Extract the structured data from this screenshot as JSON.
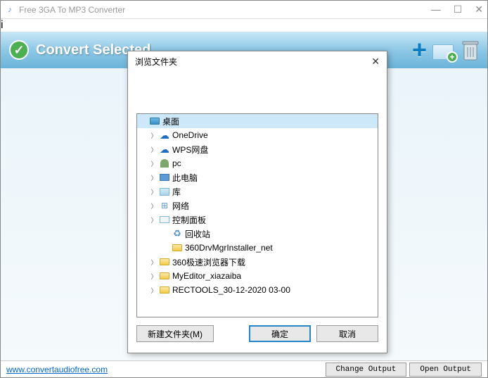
{
  "titlebar": {
    "title": "Free 3GA To MP3 Converter"
  },
  "toolbar": {
    "convert_label": "Convert Selected"
  },
  "footer": {
    "url": "www.convertaudiofree.com",
    "change_output": "Change Output",
    "open_output": "Open Output"
  },
  "dialog": {
    "title": "浏览文件夹",
    "new_folder": "新建文件夹(M)",
    "ok": "确定",
    "cancel": "取消",
    "tree": [
      {
        "label": "桌面",
        "icon": "desktop",
        "level": 0,
        "selected": true,
        "expandable": false
      },
      {
        "label": "OneDrive",
        "icon": "cloud",
        "level": 1,
        "expandable": true
      },
      {
        "label": "WPS网盘",
        "icon": "cloud",
        "level": 1,
        "expandable": true
      },
      {
        "label": "pc",
        "icon": "person",
        "level": 1,
        "expandable": true
      },
      {
        "label": "此电脑",
        "icon": "computer",
        "level": 1,
        "expandable": true
      },
      {
        "label": "库",
        "icon": "lib",
        "level": 1,
        "expandable": true
      },
      {
        "label": "网络",
        "icon": "network",
        "level": 1,
        "expandable": true
      },
      {
        "label": "控制面板",
        "icon": "panel",
        "level": 1,
        "expandable": true
      },
      {
        "label": "回收站",
        "icon": "recycle",
        "level": 2,
        "expandable": false
      },
      {
        "label": "360DrvMgrInstaller_net",
        "icon": "folder",
        "level": 2,
        "expandable": false
      },
      {
        "label": "360极速浏览器下载",
        "icon": "folder",
        "level": 1,
        "expandable": true
      },
      {
        "label": "MyEditor_xiazaiba",
        "icon": "folder",
        "level": 1,
        "expandable": true
      },
      {
        "label": "RECTOOLS_30-12-2020 03-00",
        "icon": "folder",
        "level": 1,
        "expandable": true
      }
    ]
  }
}
